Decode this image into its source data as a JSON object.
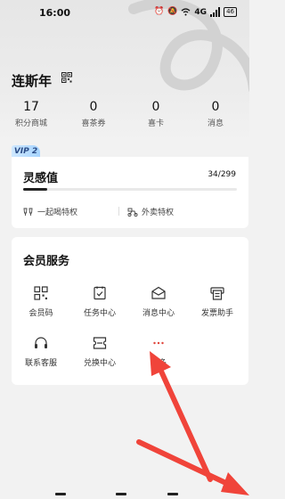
{
  "status_bar": {
    "time": "16:00",
    "network": "4G",
    "battery": "46"
  },
  "user": {
    "name": "连斯年"
  },
  "stats": [
    {
      "value": "17",
      "label": "积分商城"
    },
    {
      "value": "0",
      "label": "喜茶券"
    },
    {
      "value": "0",
      "label": "喜卡"
    },
    {
      "value": "0",
      "label": "消息"
    }
  ],
  "vip": {
    "badge": "VIP 2",
    "title": "灵感值",
    "progress_text": "34/299",
    "progress_fraction": 0.114,
    "perks": [
      {
        "label": "一起喝特权",
        "icon": "cheers-icon"
      },
      {
        "label": "外卖特权",
        "icon": "delivery-scooter-icon"
      }
    ]
  },
  "services": {
    "title": "会员服务",
    "items": [
      {
        "label": "会员码",
        "icon": "member-code-icon"
      },
      {
        "label": "任务中心",
        "icon": "task-center-icon"
      },
      {
        "label": "消息中心",
        "icon": "message-center-icon"
      },
      {
        "label": "发票助手",
        "icon": "invoice-icon"
      },
      {
        "label": "联系客服",
        "icon": "headset-icon"
      },
      {
        "label": "兑换中心",
        "icon": "exchange-ticket-icon"
      },
      {
        "label": "更多",
        "icon": "more-dots-icon"
      }
    ]
  },
  "colors": {
    "arrow": "#f0443a",
    "vip_badge": "#a6d4ff",
    "page_bg": "#f2f2f2"
  }
}
